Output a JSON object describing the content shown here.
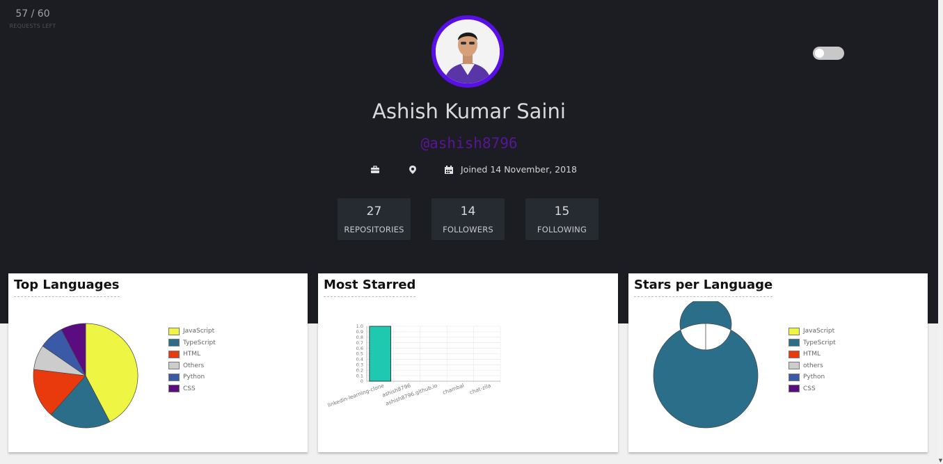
{
  "requests": {
    "count": "57 / 60",
    "label": "REQUESTS LEFT"
  },
  "profile": {
    "name": "Ashish Kumar Saini",
    "login": "@ashish8796",
    "joined": "Joined 14 November, 2018"
  },
  "stats": [
    {
      "value": "27",
      "label": "REPOSITORIES"
    },
    {
      "value": "14",
      "label": "FOLLOWERS"
    },
    {
      "value": "15",
      "label": "FOLLOWING"
    }
  ],
  "cards": {
    "top_languages": "Top Languages",
    "most_starred": "Most Starred",
    "stars_per_language": "Stars per Language"
  },
  "colors": {
    "accent": "#5a0fe6",
    "login": "#5a1596",
    "bar": "#1fc9b0"
  },
  "icons": [
    "briefcase-icon",
    "location-pin-icon",
    "calendar-icon"
  ],
  "chart_data": [
    {
      "type": "pie",
      "title": "Top Languages",
      "categories": [
        "JavaScript",
        "TypeScript",
        "HTML",
        "Others",
        "Python",
        "CSS"
      ],
      "values": [
        11,
        5,
        4,
        2,
        2,
        2
      ],
      "colors": [
        "#eef542",
        "#2a6e8a",
        "#e83a0c",
        "#cccccc",
        "#3a5aa8",
        "#5a0c80"
      ]
    },
    {
      "type": "bar",
      "title": "Most Starred",
      "categories": [
        "linkedin-learning-clone",
        "ashish8796",
        "ashish8796.github.io",
        "chambal",
        "chat-zila"
      ],
      "values": [
        1,
        0,
        0,
        0,
        0
      ],
      "yticks": [
        "0",
        "0.1",
        "0.2",
        "0.3",
        "0.4",
        "0.5",
        "0.6",
        "0.7",
        "0.8",
        "0.9",
        "1.0"
      ],
      "ylim": [
        0,
        1
      ],
      "grid": true
    },
    {
      "type": "pie",
      "title": "Stars per Language",
      "categories": [
        "JavaScript",
        "TypeScript",
        "HTML",
        "others",
        "Python",
        "CSS"
      ],
      "values": [
        0,
        1,
        0,
        0,
        0,
        0
      ],
      "colors": [
        "#eef542",
        "#2a6e8a",
        "#e83a0c",
        "#cccccc",
        "#3a5aa8",
        "#5a0c80"
      ]
    }
  ]
}
